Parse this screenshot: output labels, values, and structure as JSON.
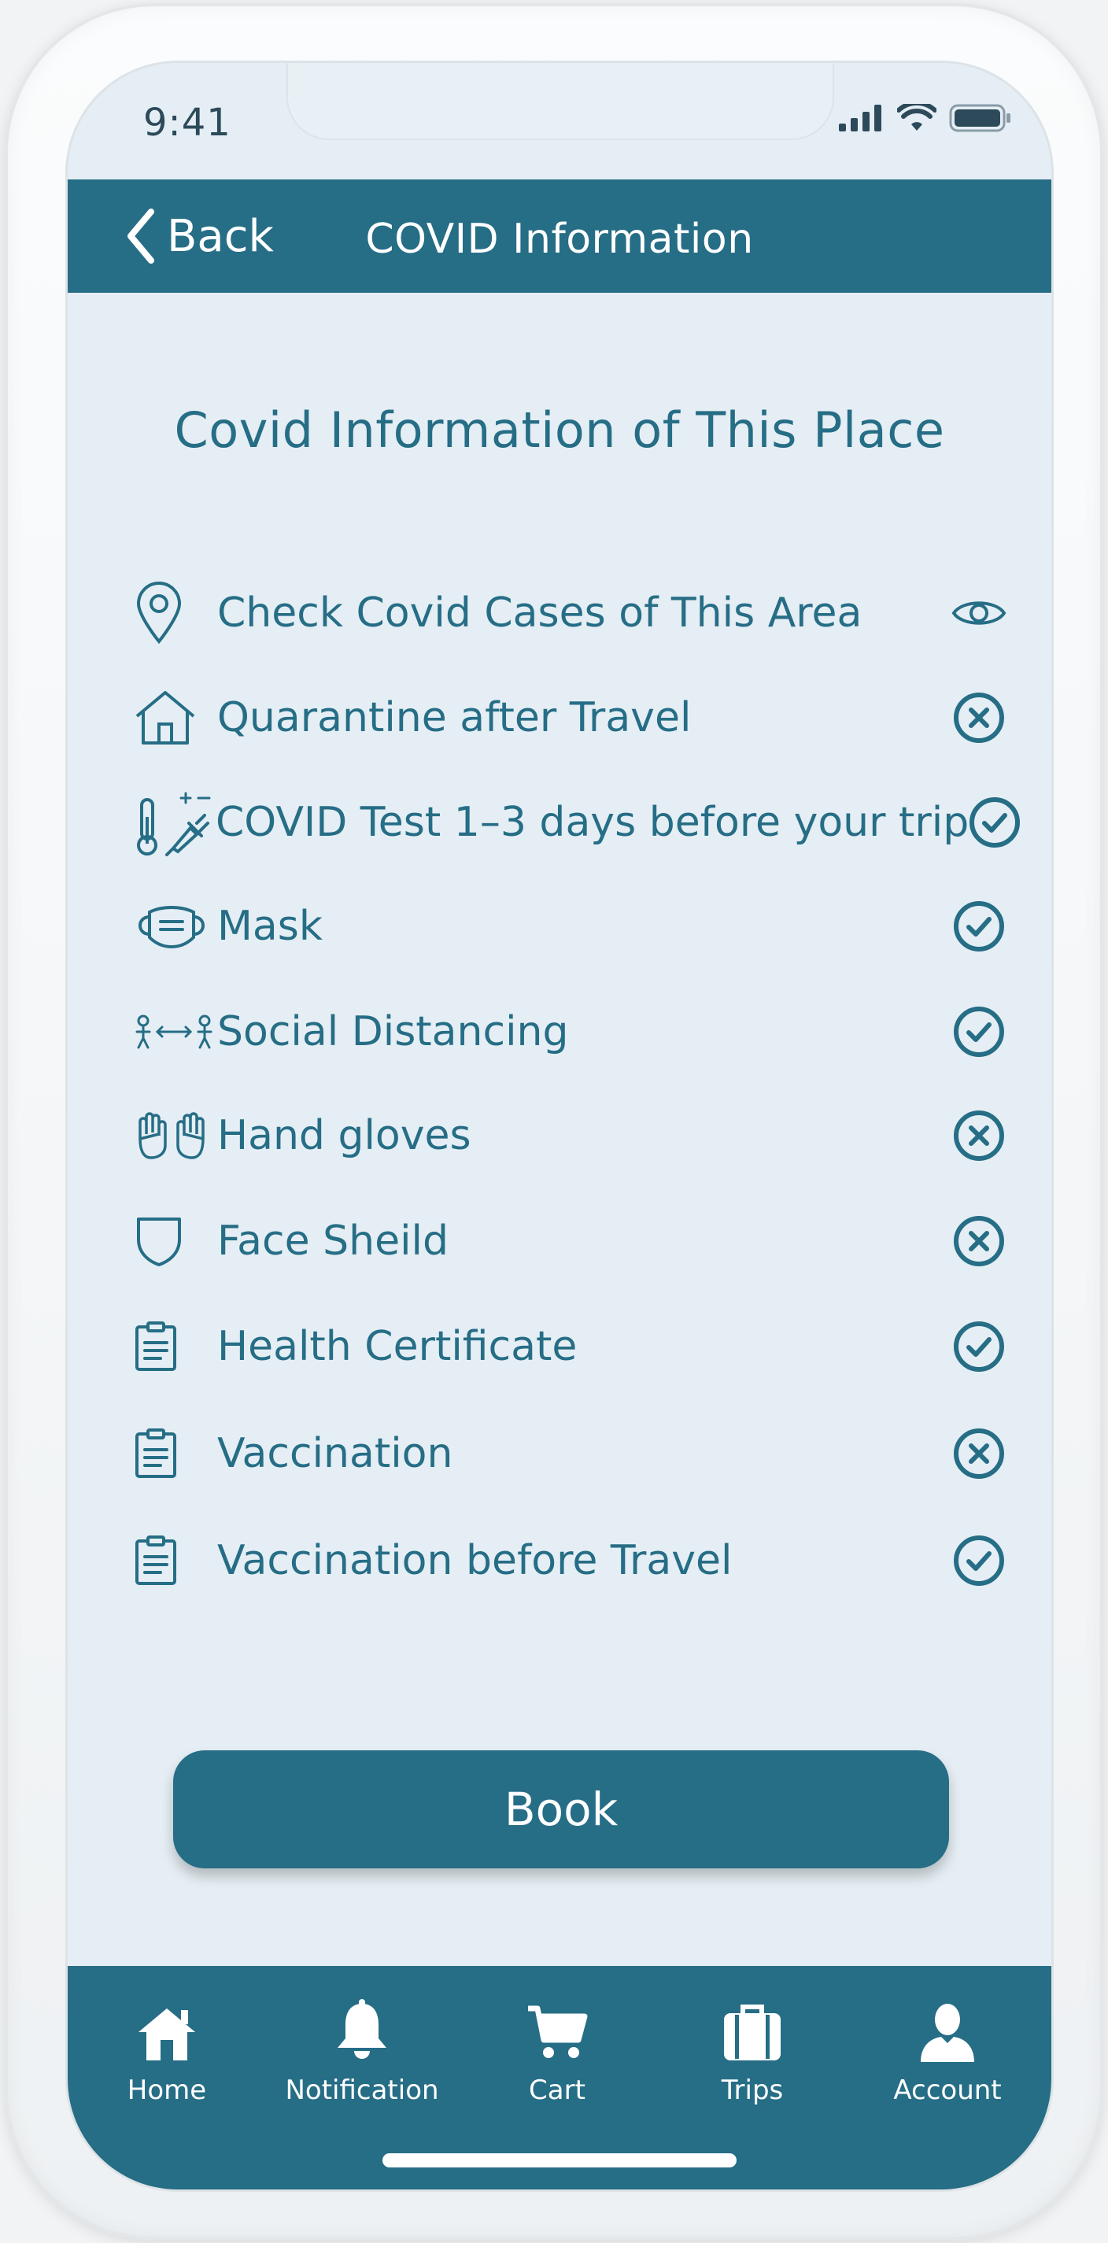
{
  "status_bar": {
    "time": "9:41"
  },
  "header": {
    "back_label": "Back",
    "title": "COVID Information"
  },
  "main": {
    "title": "Covid Information of This Place",
    "items": [
      {
        "icon": "location-pin-icon",
        "label": "Check Covid Cases of This Area",
        "status": "view"
      },
      {
        "icon": "house-icon",
        "label": "Quarantine after Travel",
        "status": "not-required"
      },
      {
        "icon": "thermometer-dropper-icon",
        "label": "COVID Test 1–3 days before your trip",
        "status": "required"
      },
      {
        "icon": "mask-icon",
        "label": "Mask",
        "status": "required"
      },
      {
        "icon": "social-distance-icon",
        "label": "Social Distancing",
        "status": "required"
      },
      {
        "icon": "gloves-icon",
        "label": "Hand gloves",
        "status": "not-required"
      },
      {
        "icon": "shield-icon",
        "label": "Face Sheild",
        "status": "not-required"
      },
      {
        "icon": "clipboard-icon",
        "label": "Health Certificate",
        "status": "required"
      },
      {
        "icon": "clipboard-icon",
        "label": "Vaccination",
        "status": "not-required"
      },
      {
        "icon": "clipboard-icon",
        "label": "Vaccination before Travel",
        "status": "required"
      }
    ],
    "book_label": "Book"
  },
  "tabbar": {
    "tabs": [
      {
        "icon": "home-icon",
        "label": "Home"
      },
      {
        "icon": "bell-icon",
        "label": "Notification"
      },
      {
        "icon": "cart-icon",
        "label": "Cart"
      },
      {
        "icon": "briefcase-icon",
        "label": "Trips"
      },
      {
        "icon": "user-icon",
        "label": "Account"
      }
    ]
  },
  "colors": {
    "primary": "#266d86",
    "background": "#e5eef4",
    "text_on_primary": "#ffffff"
  }
}
